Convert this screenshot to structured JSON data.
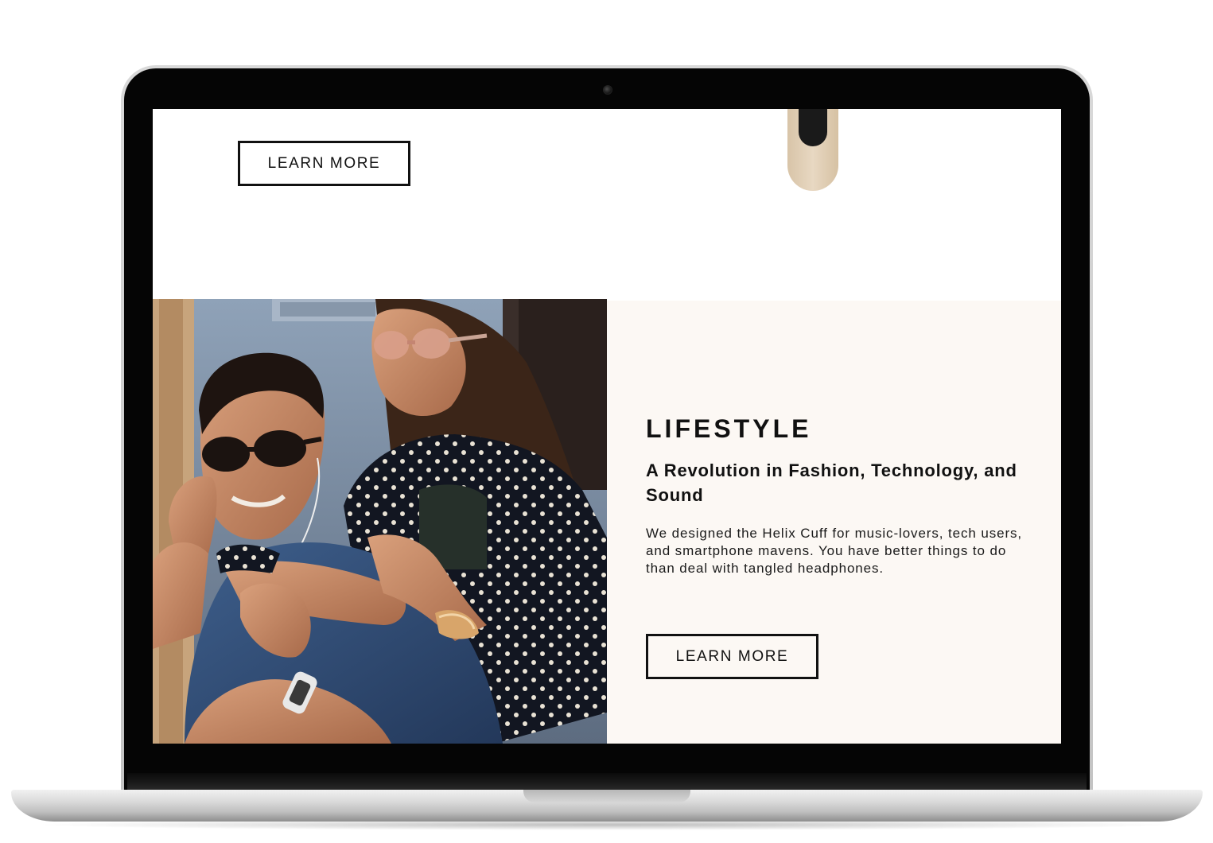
{
  "top_section": {
    "cta_label": "LEARN MORE"
  },
  "lifestyle": {
    "heading": "LIFESTYLE",
    "subheading": "A Revolution in Fashion, Technology, and Sound",
    "body": "We designed the Helix Cuff for music-lovers,  tech users, and smartphone mavens. You have better things to do than deal with tangled headphones.",
    "cta_label": "LEARN MORE",
    "panel_color": "#fcf8f4"
  },
  "device": {
    "frame_color": "#050505",
    "body_color": "#d9d9d9"
  }
}
